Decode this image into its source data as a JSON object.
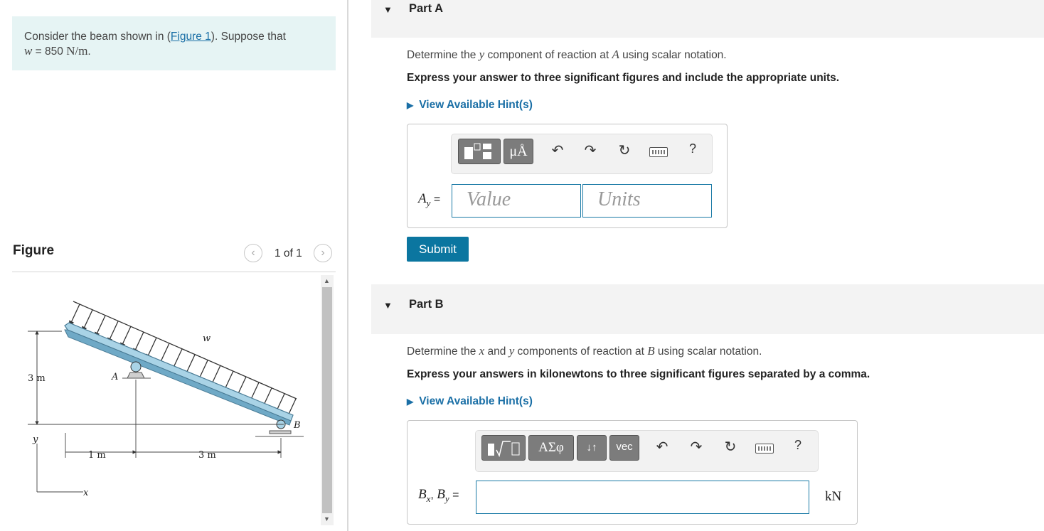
{
  "problem": {
    "text_before": "Consider the beam shown in (",
    "figure_link": "Figure 1",
    "text_after": "). Suppose that",
    "w_symbol": "w",
    "w_eq": " = 850 ",
    "w_unit": "N/m",
    "w_period": "."
  },
  "figure": {
    "title": "Figure",
    "pager": "1 of 1",
    "prev_icon": "chevron-left-icon",
    "next_icon": "chevron-right-icon",
    "labels": {
      "load": "w",
      "point_a": "A",
      "point_b": "B",
      "height": "3 m",
      "span_1": "1 m",
      "span_2": "3 m",
      "axis_y": "y",
      "axis_x": "x"
    }
  },
  "part_a": {
    "title": "Part A",
    "question_pre": "Determine the ",
    "question_var": "y",
    "question_mid": " component of reaction at ",
    "question_point": "A",
    "question_post": "  using scalar notation.",
    "instruction": "Express your answer to three significant figures and include the appropriate units.",
    "hint": "View Available Hint(s)",
    "answer_label": "A",
    "answer_sub": "y",
    "answer_eq": " =",
    "value_placeholder": "Value",
    "units_placeholder": "Units",
    "submit": "Submit",
    "toolbar": {
      "templates_icon": "templates-icon",
      "units_btn": "μÅ",
      "icons": [
        "undo-icon",
        "redo-icon",
        "reset-icon",
        "keyboard-icon",
        "help-icon"
      ],
      "help": "?"
    }
  },
  "part_b": {
    "title": "Part B",
    "question_pre": "Determine the ",
    "question_var_x": "x",
    "question_and": " and ",
    "question_var_y": "y",
    "question_mid": " components of reaction at ",
    "question_point": "B",
    "question_post": " using scalar notation.",
    "instruction": "Express your answers in kilonewtons to three significant figures separated by a comma.",
    "hint": "View Available Hint(s)",
    "answer_label": "B",
    "answer_sub_x": "x",
    "answer_sep": ", ",
    "answer_sub_y": "y",
    "answer_eq": " =",
    "unit": "kN",
    "toolbar": {
      "templates_icon": "sqrt-template-icon",
      "greek_btn": "ΑΣφ",
      "arrows_btn": "↓↑",
      "vec_btn": "vec",
      "icons": [
        "undo-icon",
        "redo-icon",
        "reset-icon",
        "keyboard-icon",
        "help-icon"
      ],
      "help": "?"
    }
  },
  "colors": {
    "accent": "#0b76a0",
    "link": "#1a6fa6",
    "problem_bg": "#e6f4f4",
    "beam": "#a9d3e6"
  }
}
